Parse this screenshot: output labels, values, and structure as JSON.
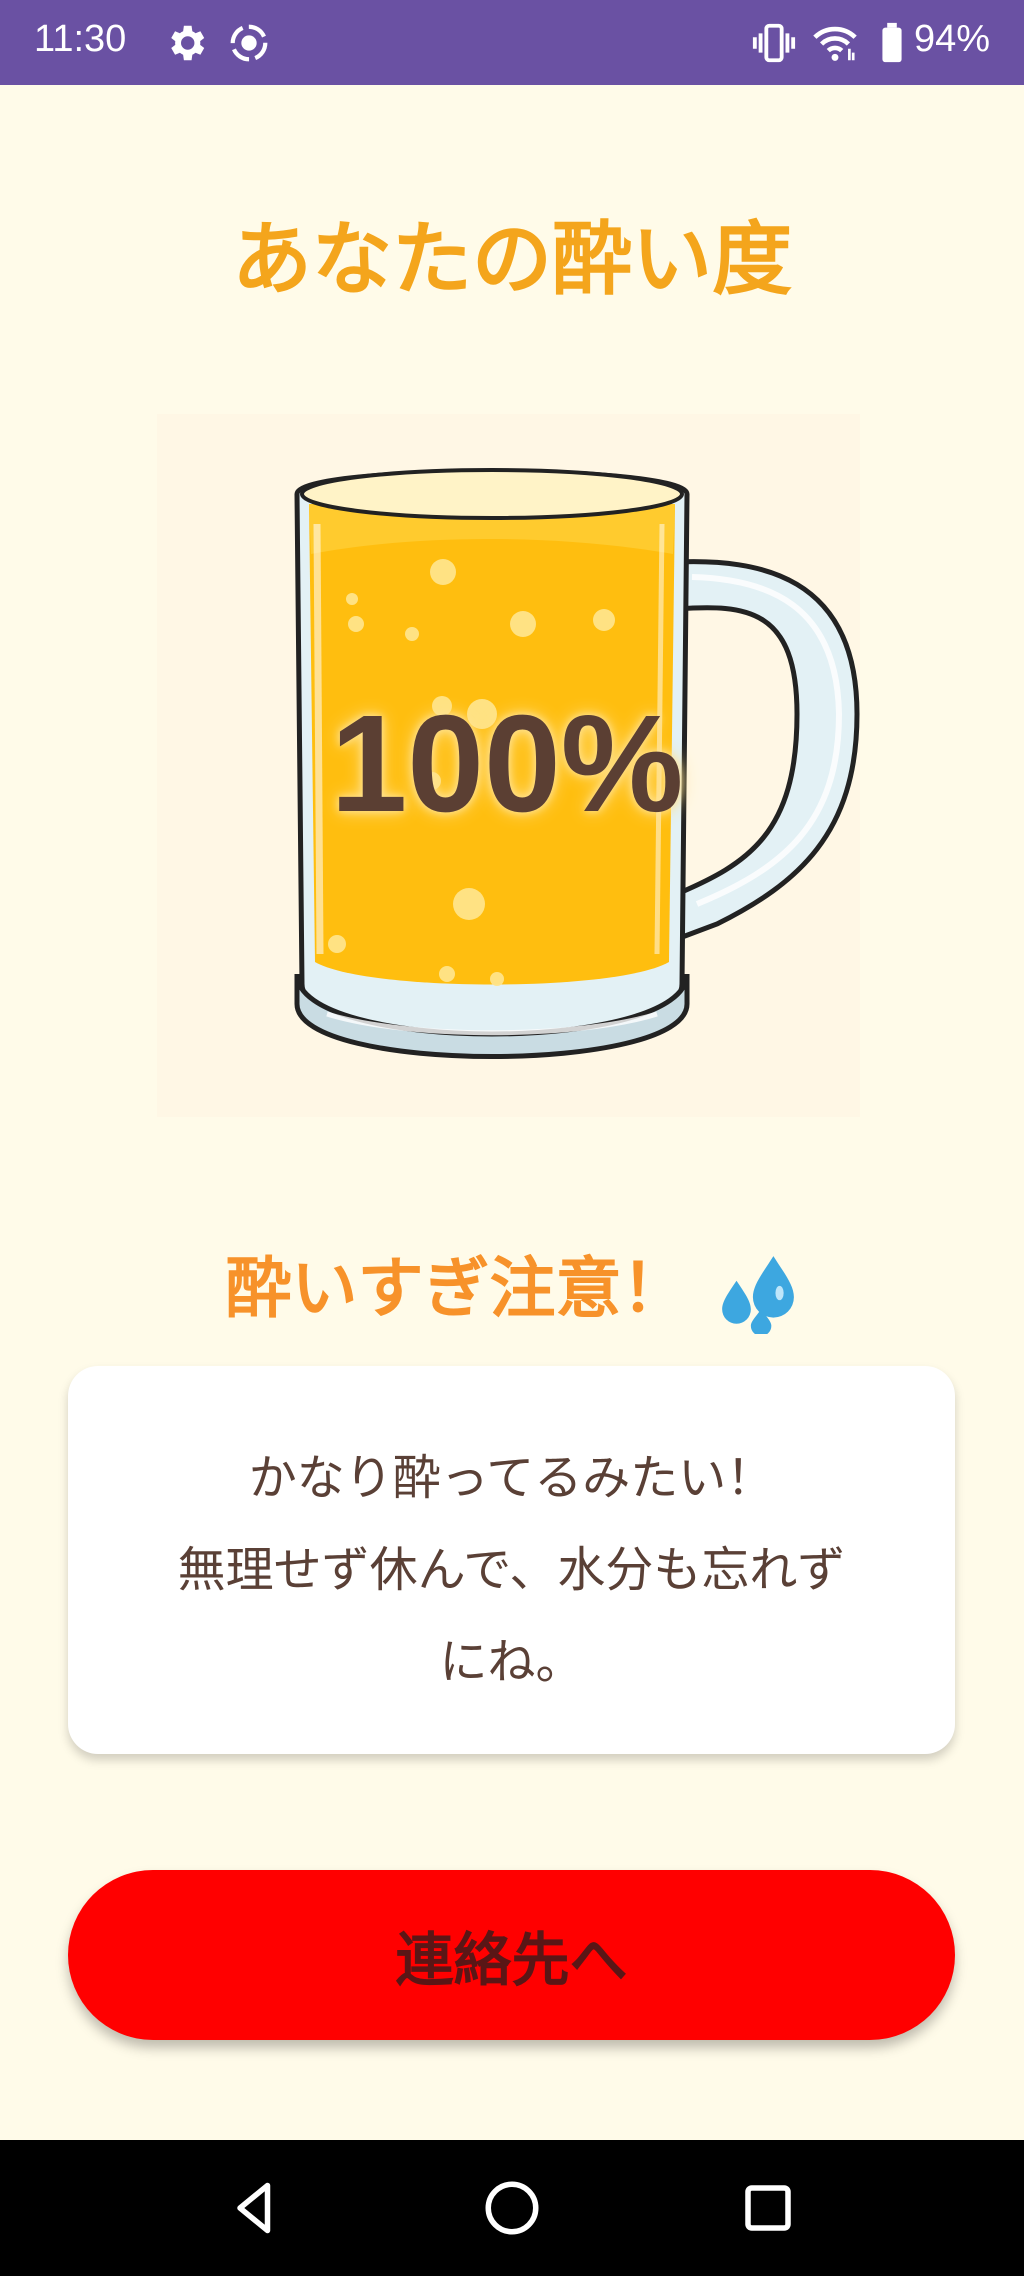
{
  "status_bar": {
    "time": "11:30",
    "left_icons": [
      "gear-icon",
      "screen-record-icon"
    ],
    "right_icons": [
      "vibrate-icon",
      "wifi-icon",
      "battery-icon"
    ],
    "battery": "94%"
  },
  "page": {
    "title": "あなたの酔い度",
    "percent": "100%",
    "drunk_level": 1.0,
    "warning": "酔いすぎ注意！",
    "warning_icon": "sweat-drops-icon",
    "message_lines": [
      "かなり酔ってるみたい！",
      "無理せず休んで、水分も忘れず",
      "にね。"
    ],
    "contact_button": "連絡先へ"
  },
  "nav_bar": {
    "buttons": [
      "back-icon",
      "home-icon",
      "recents-icon"
    ]
  },
  "colors": {
    "status_bar": "#6A51A3",
    "background": "#FFFBE9",
    "title": "#F4A51C",
    "warning": "#F7922A",
    "button": "#FF0000",
    "beer": "#FFC107"
  }
}
